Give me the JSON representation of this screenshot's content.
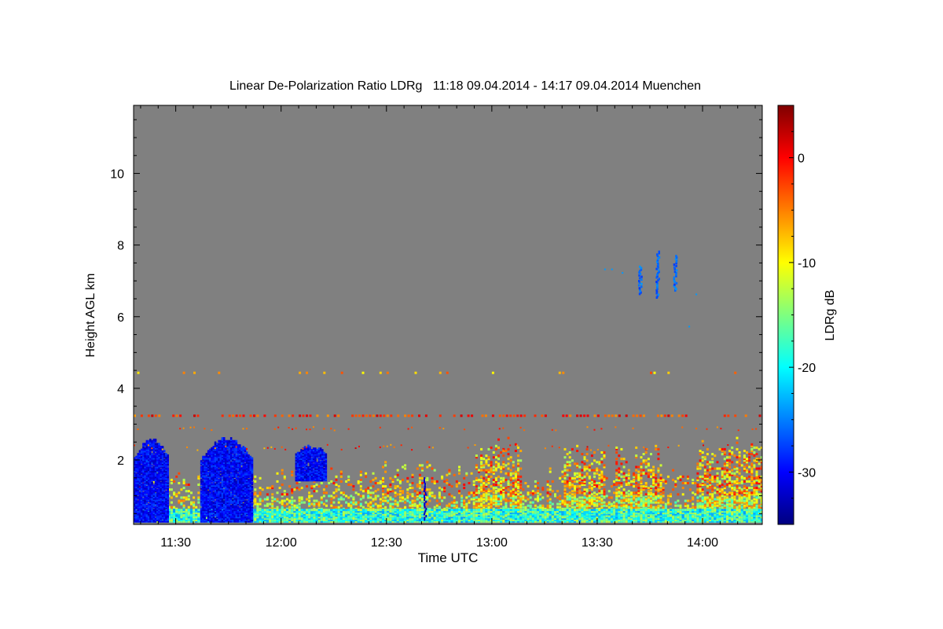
{
  "chart_data": {
    "type": "heatmap",
    "title": "Linear De-Polarization Ratio LDRg   11:18 09.04.2014 - 14:17 09.04.2014 Muenchen",
    "xlabel": "Time UTC",
    "ylabel": "Height AGL km",
    "colorbar_label": "LDRg dB",
    "x_range_minutes_utc": [
      678,
      857
    ],
    "y_range_km": [
      0.2,
      11.9
    ],
    "x_ticks": [
      {
        "minute": 690,
        "label": "11:30"
      },
      {
        "minute": 720,
        "label": "12:00"
      },
      {
        "minute": 750,
        "label": "12:30"
      },
      {
        "minute": 780,
        "label": "13:00"
      },
      {
        "minute": 810,
        "label": "13:30"
      },
      {
        "minute": 840,
        "label": "14:00"
      }
    ],
    "y_ticks": [
      {
        "value": 2,
        "label": "2"
      },
      {
        "value": 4,
        "label": "4"
      },
      {
        "value": 6,
        "label": "6"
      },
      {
        "value": 8,
        "label": "8"
      },
      {
        "value": 10,
        "label": "10"
      }
    ],
    "colorbar_range_db": [
      -35,
      5
    ],
    "colorbar_ticks": [
      {
        "value": 0,
        "label": "0"
      },
      {
        "value": -10,
        "label": "-10"
      },
      {
        "value": -20,
        "label": "-20"
      },
      {
        "value": -30,
        "label": "-30"
      }
    ],
    "no_data_color": "#808080",
    "colormap": "jet",
    "features": [
      {
        "name": "low-LDR cloud blobs",
        "ldr_db": -32,
        "regions": [
          [
            678,
            688,
            0.25,
            2.5
          ],
          [
            697,
            712,
            0.25,
            2.5
          ],
          [
            724,
            733,
            1.4,
            2.3
          ]
        ]
      },
      {
        "name": "boundary layer aerosol",
        "ldr_db": -9,
        "time_range": [
          678,
          857
        ],
        "height_range_km": [
          0.25,
          2.5
        ]
      },
      {
        "name": "near-surface layer",
        "ldr_db": -22,
        "time_range": [
          678,
          857
        ],
        "height_range_km": [
          0.25,
          0.6
        ]
      },
      {
        "name": "lofted layer 1",
        "ldr_db": -3,
        "height_km": 3.2
      },
      {
        "name": "lofted layer 2",
        "ldr_db": -7,
        "height_km": 4.4
      },
      {
        "name": "cirrus streaks",
        "ldr_db": -28,
        "time_range": [
          820,
          834
        ],
        "height_range_km": [
          6.5,
          7.8
        ]
      }
    ]
  }
}
